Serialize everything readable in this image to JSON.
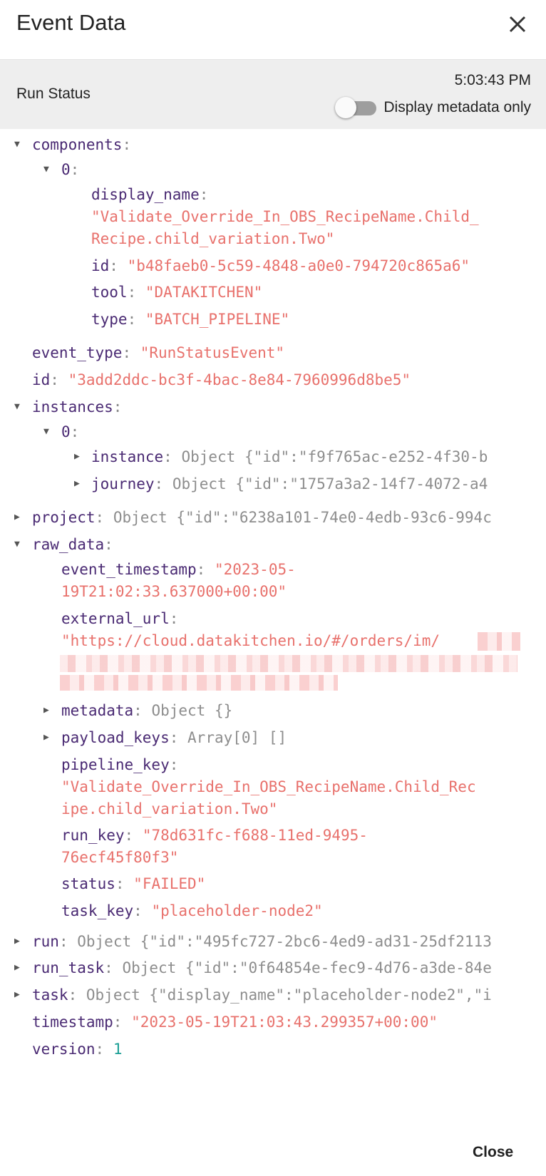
{
  "dialog": {
    "title": "Event Data",
    "status_label": "Run Status",
    "time": "5:03:43 PM",
    "toggle_label": "Display metadata only",
    "toggle_on": false,
    "close_label": "Close"
  },
  "tree": {
    "components_key": "components",
    "c0_index": "0",
    "display_name_key": "display_name",
    "display_name_line1": "\"Validate_Override_In_OBS_RecipeName.Child_",
    "display_name_line2": "Recipe.child_variation.Two\"",
    "c_id_key": "id",
    "c_id_val": "\"b48faeb0-5c59-4848-a0e0-794720c865a6\"",
    "tool_key": "tool",
    "tool_val": "\"DATAKITCHEN\"",
    "type_key": "type",
    "type_val": "\"BATCH_PIPELINE\"",
    "event_type_key": "event_type",
    "event_type_val": "\"RunStatusEvent\"",
    "id_key": "id",
    "id_val": "\"3add2ddc-bc3f-4bac-8e84-7960996d8be5\"",
    "instances_key": "instances",
    "i0_index": "0",
    "instance_key": "instance",
    "instance_val": "Object {\"id\":\"f9f765ac-e252-4f30-b",
    "journey_key": "journey",
    "journey_val": "Object {\"id\":\"1757a3a2-14f7-4072-a4",
    "project_key": "project",
    "project_val": "Object {\"id\":\"6238a101-74e0-4edb-93c6-994c",
    "raw_data_key": "raw_data",
    "event_timestamp_key": "event_timestamp",
    "event_timestamp_line1": "\"2023-05-",
    "event_timestamp_line2": "19T21:02:33.637000+00:00\"",
    "external_url_key": "external_url",
    "external_url_line1": "\"https://cloud.datakitchen.io/#/orders/im/",
    "metadata_key": "metadata",
    "metadata_val": "Object {}",
    "payload_keys_key": "payload_keys",
    "payload_keys_val": "Array[0] []",
    "pipeline_key_key": "pipeline_key",
    "pipeline_key_line1": "\"Validate_Override_In_OBS_RecipeName.Child_Rec",
    "pipeline_key_line2": "ipe.child_variation.Two\"",
    "run_key_key": "run_key",
    "run_key_line1": "\"78d631fc-f688-11ed-9495-",
    "run_key_line2": "76ecf45f80f3\"",
    "status_key": "status",
    "status_val": "\"FAILED\"",
    "task_key_key": "task_key",
    "task_key_val": "\"placeholder-node2\"",
    "run_obj_key": "run",
    "run_obj_val": "Object {\"id\":\"495fc727-2bc6-4ed9-ad31-25df2113",
    "run_task_key": "run_task",
    "run_task_val": "Object {\"id\":\"0f64854e-fec9-4d76-a3de-84e",
    "task_obj_key": "task",
    "task_obj_val": "Object {\"display_name\":\"placeholder-node2\",\"i",
    "timestamp_key": "timestamp",
    "timestamp_val": "\"2023-05-19T21:03:43.299357+00:00\"",
    "version_key": "version",
    "version_val": "1",
    "colon": ":"
  },
  "colors": {
    "key": "#4a2a73",
    "string": "#e8716c",
    "number": "#1a9e94",
    "object_preview": "#8d8d8d",
    "status_bar_bg": "#eeeeee"
  },
  "icons": {
    "close": "close-x-icon",
    "expanded": "triangle-down-icon",
    "collapsed": "triangle-right-icon"
  }
}
